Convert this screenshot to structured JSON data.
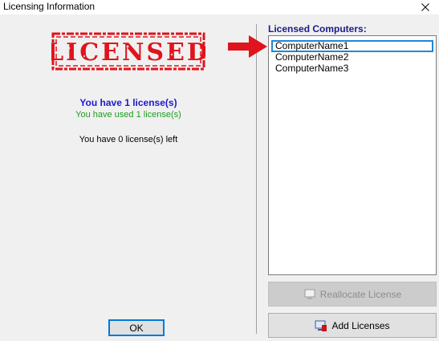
{
  "window": {
    "title": "Licensing Information",
    "close_glyph": "✕"
  },
  "stamp": {
    "text": "LICENSED",
    "color": "#e0141c"
  },
  "messages": {
    "have": "You have 1 license(s)",
    "used": "You have used 1 license(s)",
    "left": "You have 0 license(s) left"
  },
  "licensed_computers": {
    "label": "Licensed Computers:",
    "items": [
      "ComputerName1",
      "ComputerName2",
      "ComputerName3"
    ],
    "selected_index": 0
  },
  "buttons": {
    "reallocate": "Reallocate License",
    "add": "Add Licenses",
    "ok": "OK"
  },
  "colors": {
    "accent": "#0078d7",
    "arrow": "#e0141c"
  },
  "icons": {
    "close": "close-icon",
    "reallocate": "reallocate-icon",
    "add": "add-licenses-icon",
    "arrow": "red-arrow-icon"
  }
}
